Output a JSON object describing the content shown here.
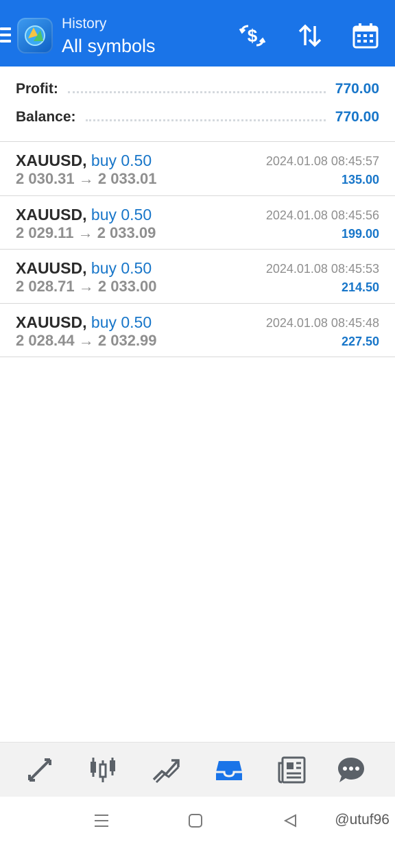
{
  "header": {
    "subtitle": "History",
    "title": "All symbols",
    "menu_icon": "hamburger-menu-icon",
    "logo_icon": "metatrader-logo-icon",
    "actions": [
      "dollar-exchange-icon",
      "sort-icon",
      "calendar-icon"
    ],
    "color": "#1a74e8"
  },
  "summary": {
    "profit_label": "Profit:",
    "profit_value": "770.00",
    "balance_label": "Balance:",
    "balance_value": "770.00"
  },
  "deals": [
    {
      "symbol": "XAUUSD,",
      "type": "buy 0.50",
      "open_price": "2 030.31",
      "close_price": "2 033.01",
      "time": "2024.01.08 08:45:57",
      "profit": "135.00"
    },
    {
      "symbol": "XAUUSD,",
      "type": "buy 0.50",
      "open_price": "2 029.11",
      "close_price": "2 033.09",
      "time": "2024.01.08 08:45:56",
      "profit": "199.00"
    },
    {
      "symbol": "XAUUSD,",
      "type": "buy 0.50",
      "open_price": "2 028.71",
      "close_price": "2 033.00",
      "time": "2024.01.08 08:45:53",
      "profit": "214.50"
    },
    {
      "symbol": "XAUUSD,",
      "type": "buy 0.50",
      "open_price": "2 028.44",
      "close_price": "2 032.99",
      "time": "2024.01.08 08:45:48",
      "profit": "227.50"
    }
  ],
  "arrow": "→",
  "tabs": [
    {
      "icon": "quotes-icon",
      "active": false
    },
    {
      "icon": "chart-candles-icon",
      "active": false
    },
    {
      "icon": "trade-icon",
      "active": false
    },
    {
      "icon": "history-inbox-icon",
      "active": true
    },
    {
      "icon": "news-icon",
      "active": false
    },
    {
      "icon": "chat-icon",
      "active": false
    }
  ],
  "system_nav": {
    "icons": [
      "recents-icon",
      "home-icon",
      "back-icon"
    ],
    "watermark": "@utuf96"
  },
  "colors": {
    "accent": "#1876c9",
    "active_tab": "#1a74e8",
    "inactive_tab": "#5b6168"
  }
}
